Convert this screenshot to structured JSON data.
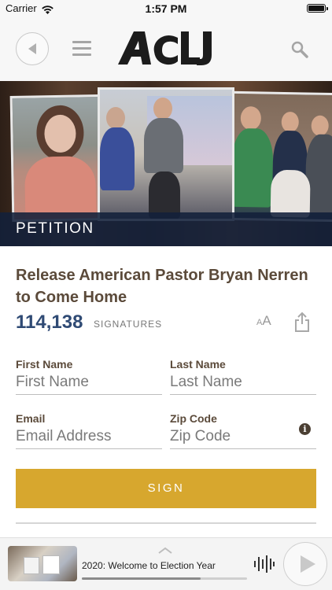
{
  "status_bar": {
    "carrier": "Carrier",
    "time": "1:57 PM",
    "battery_level": 1.0
  },
  "nav": {
    "back_icon": "back-arrow-icon",
    "menu_icon": "hamburger-menu-icon",
    "logo_text": "ACLJ",
    "search_icon": "search-icon"
  },
  "hero": {
    "band_label": "PETITION"
  },
  "petition": {
    "title": "Release American Pastor Bryan Nerren to Come Home",
    "signature_count": "114,138",
    "signature_label": "SIGNATURES",
    "text_size_icon": "text-size-icon",
    "share_icon": "share-icon"
  },
  "form": {
    "first_name": {
      "label": "First Name",
      "placeholder": "First Name",
      "value": ""
    },
    "last_name": {
      "label": "Last Name",
      "placeholder": "Last Name",
      "value": ""
    },
    "email": {
      "label": "Email",
      "placeholder": "Email Address",
      "value": ""
    },
    "zip": {
      "label": "Zip Code",
      "placeholder": "Zip Code",
      "value": "",
      "info_icon": "info-icon"
    },
    "sign_label": "SIGN"
  },
  "colors": {
    "accent_gold": "#d7a72e",
    "count_blue": "#2f4a74",
    "title_brown": "#5b4a3a",
    "band_navy": "#12203a"
  },
  "player": {
    "track_title": "2020: Welcome to Election Year",
    "expand_icon": "chevron-up-icon",
    "waveform_icon": "waveform-icon",
    "play_icon": "play-icon",
    "progress": 0.72
  }
}
